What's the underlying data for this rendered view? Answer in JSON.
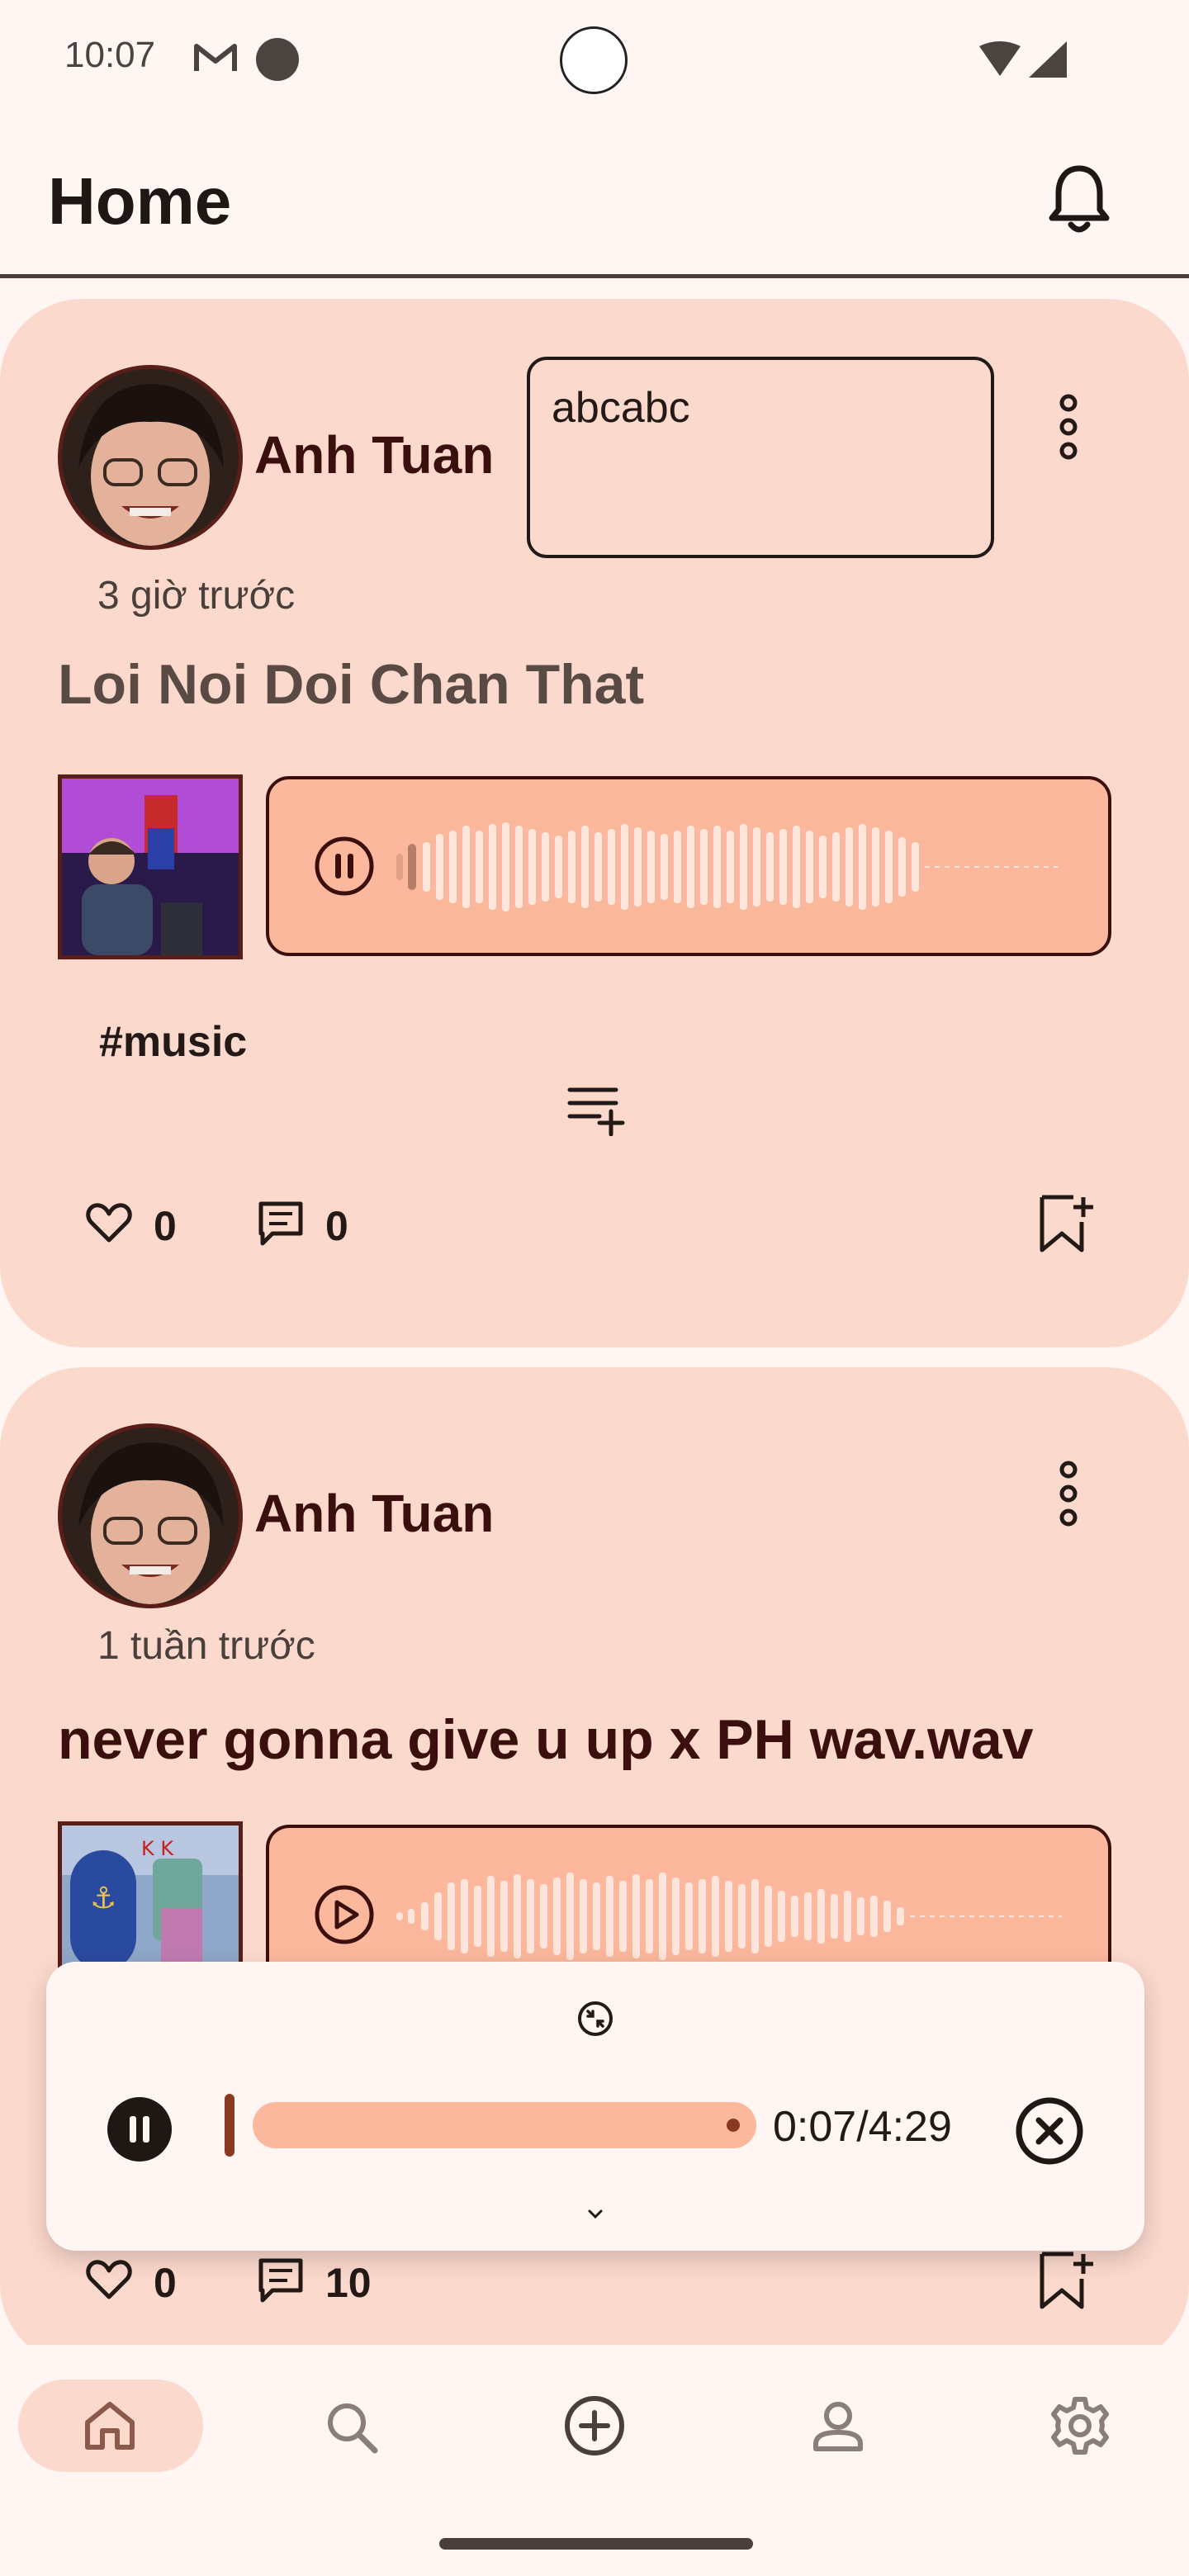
{
  "status_bar": {
    "time": "10:07"
  },
  "header": {
    "title": "Home"
  },
  "posts": [
    {
      "author": "Anh Tuan",
      "time_ago": "3 giờ trước",
      "title": "Loi Noi Doi Chan That",
      "comment_input_value": "abcabc",
      "hashtag": "#music",
      "likes": "0",
      "comments": "0",
      "player_state": "playing"
    },
    {
      "author": "Anh Tuan",
      "time_ago": "1 tuần trước",
      "title": "never gonna give u up x PH wav.wav",
      "likes": "0",
      "comments": "10",
      "player_state": "paused"
    }
  ],
  "mini_player": {
    "time_display": "0:07/4:29",
    "progress": 0.027
  },
  "bottom_nav": {
    "items": [
      "home",
      "search",
      "create",
      "profile",
      "settings"
    ],
    "active": "home"
  },
  "colors": {
    "background": "#fff6f3",
    "card": "#fcd9cd",
    "player": "#fbb89c",
    "accent_dark": "#3b0f0d"
  }
}
